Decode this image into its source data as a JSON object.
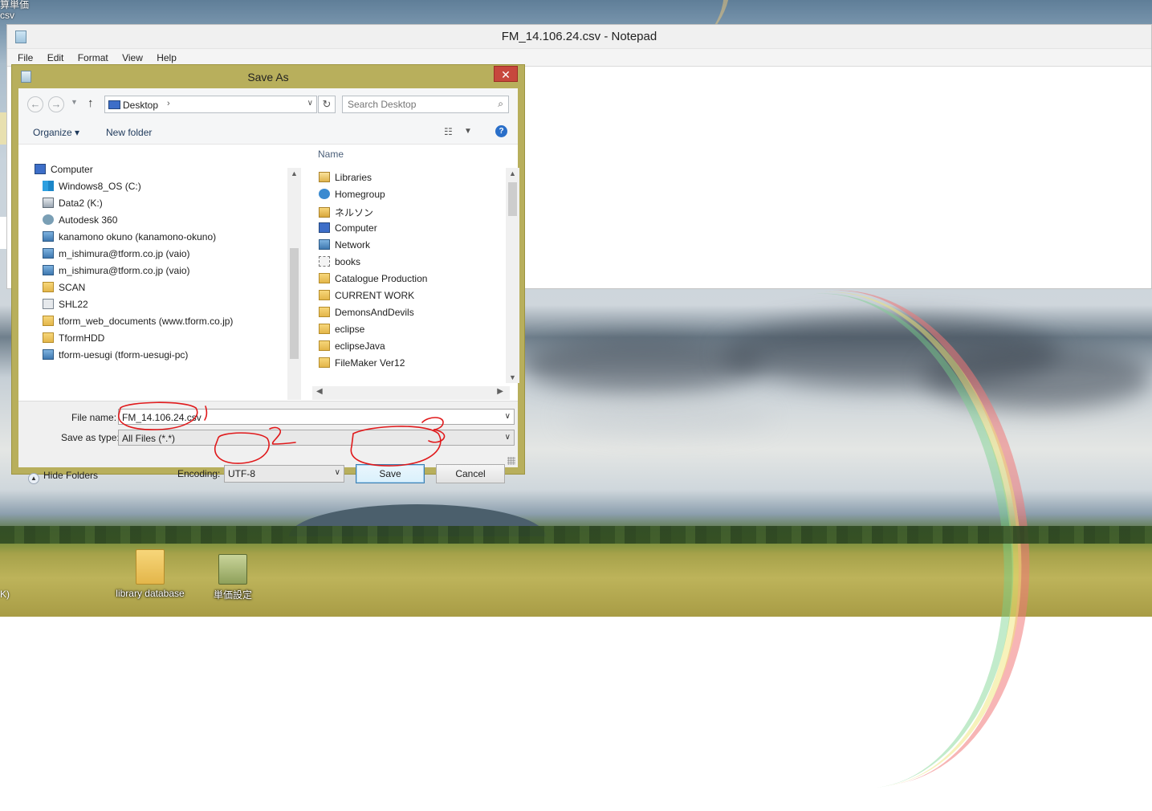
{
  "desktop": {
    "top_left_text_line1": "算単価",
    "top_left_text_line2": "csv",
    "left_edge_label": "K)",
    "icons": [
      {
        "label": "library database",
        "icon": "folder-icon"
      },
      {
        "label": "単価設定",
        "icon": "file-cabinet-icon"
      }
    ]
  },
  "notepad": {
    "title": "FM_14.106.24.csv - Notepad",
    "menu": [
      "File",
      "Edit",
      "Format",
      "View",
      "Help"
    ]
  },
  "save_dialog": {
    "title": "Save As",
    "close_symbol": "✕",
    "address": {
      "location": "Desktop",
      "search_placeholder": "Search Desktop"
    },
    "toolbar": {
      "organize_label": "Organize ▾",
      "new_folder_label": "New folder"
    },
    "nav_pane": [
      {
        "label": "Computer",
        "icon": "computer-icon"
      },
      {
        "label": "Windows8_OS (C:)",
        "icon": "windows-drive-icon"
      },
      {
        "label": "Data2 (K:)",
        "icon": "drive-icon"
      },
      {
        "label": "Autodesk 360",
        "icon": "cloud-icon"
      },
      {
        "label": "kanamono okuno (kanamono-okuno)",
        "icon": "network-computer-icon"
      },
      {
        "label": "m_ishimura@tform.co.jp (vaio)",
        "icon": "network-computer-icon"
      },
      {
        "label": "m_ishimura@tform.co.jp (vaio)",
        "icon": "network-computer-icon"
      },
      {
        "label": "SCAN",
        "icon": "folder-icon"
      },
      {
        "label": "SHL22",
        "icon": "phone-icon"
      },
      {
        "label": "tform_web_documents (www.tform.co.jp)",
        "icon": "folder-icon"
      },
      {
        "label": "TformHDD",
        "icon": "folder-icon"
      },
      {
        "label": "tform-uesugi (tform-uesugi-pc)",
        "icon": "network-computer-icon"
      }
    ],
    "file_list": {
      "column_header": "Name",
      "items": [
        {
          "label": "Libraries",
          "icon": "libraries-icon"
        },
        {
          "label": "Homegroup",
          "icon": "homegroup-icon"
        },
        {
          "label": "ネルソン",
          "icon": "user-folder-icon"
        },
        {
          "label": "Computer",
          "icon": "computer-icon"
        },
        {
          "label": "Network",
          "icon": "network-icon"
        },
        {
          "label": "books",
          "icon": "books-icon"
        },
        {
          "label": "Catalogue Production",
          "icon": "folder-icon"
        },
        {
          "label": "CURRENT WORK",
          "icon": "folder-icon"
        },
        {
          "label": "DemonsAndDevils",
          "icon": "folder-icon"
        },
        {
          "label": "eclipse",
          "icon": "folder-icon"
        },
        {
          "label": "eclipseJava",
          "icon": "folder-icon"
        },
        {
          "label": "FileMaker Ver12",
          "icon": "folder-icon"
        }
      ]
    },
    "form": {
      "file_name_label": "File name:",
      "file_name_value": "FM_14.106.24.csv",
      "save_as_type_label": "Save as type:",
      "save_as_type_value": "All Files  (*.*)",
      "encoding_label": "Encoding:",
      "encoding_value": "UTF-8",
      "hide_folders_label": "Hide Folders",
      "save_button": "Save",
      "cancel_button": "Cancel"
    }
  },
  "annotations": {
    "color": "#e0191b",
    "labels": [
      "1",
      "2",
      "3"
    ]
  }
}
